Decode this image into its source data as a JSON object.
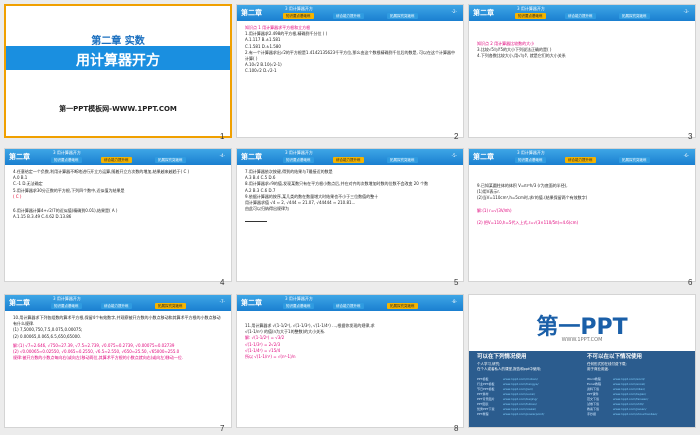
{
  "slides": [
    {
      "num": "1",
      "chapter": "第二章 实数",
      "title": "用计算器开方",
      "site": "第一PPT模板网-WWW.1PPT.COM"
    },
    {
      "num": "2",
      "header": "第二章",
      "section": "3 用计算器开方",
      "tabs": [
        "知识要点基础练",
        "综合能力提升练",
        "拓展探究突破练"
      ],
      "page": "-2-",
      "lines": [
        "知识点 1  用计算器求平方根和立方根",
        "1.用计算器求2.498的平方根,精确到千分位 (    )",
        "A.1.117          B.±1.581",
        "C.1.581          D.±1.580",
        "2.有一个计算器求出√2的平方根是1.4142135623千平方位,那么由这个数根精确到千位后的数是, 可以在这个计算器中计算(    )",
        "A.10√2          B.10(√2-1)",
        "C.100√2         D.√2-1"
      ]
    },
    {
      "num": "3",
      "header": "第二章",
      "section": "3 用计算器开方",
      "tabs": [
        "知识要点基础练",
        "综合能力提升练",
        "拓展探究突破练"
      ],
      "page": "-3-",
      "lines": [
        "知识点 2  用计算器比较数的大小",
        "3.比较√5与∛5的大小下列说法正确的是(   )",
        "4.下列各数比较大小,用√与∛, 就是它们的大小关系"
      ]
    },
    {
      "num": "4",
      "header": "第二章",
      "section": "3 用计算器开方",
      "tabs": [
        "知识要点基础练",
        "综合能力提升练",
        "拓展探究突破练"
      ],
      "page": "-4-",
      "lines": [
        "4.任意给定一个负数,利用计算器不断地进行开立方运算,随着开立方次数的增加,结果越来越趋于(  C  )",
        "A.0        B.1",
        "C.-1       D.无法确定",
        "5.用计算器求30分正数的平方根,下列四个数中,近似值为结果是",
        "(  C  )",
        "6.用计算器计算4+√2/7的近似值(精确到0.01),结果是(  A  )",
        "A.1.15   B.3.49  C.4.62   D.13.86"
      ]
    },
    {
      "num": "5",
      "header": "第二章",
      "section": "3 用计算器开方",
      "tabs": [
        "知识要点基础练",
        "综合能力提升练",
        "拓展探究突破练"
      ],
      "page": "-5-",
      "lines": [
        "7.用计算器依次按键,得到的结果与7最接近的数是",
        "A.3      B.4      C.5      D.6",
        "8.用计算器求√9的值,发现某数只有在平方根小数点后,并在对齐的次数增加时数的位数不会改变 20 个数",
        "A.2      B.3      C.6      D.7",
        "9.依据计算器的按序,某几类的数在数量增大时结果也不小于三位数值的整十",
        "用计算器求值 √4 ≈ 2, √444 ≈ 21.07, √44444 ≈ 210.81...",
        "由此可以归纳得出规律为"
      ]
    },
    {
      "num": "6",
      "header": "第二章",
      "section": "3 用计算器开方",
      "tabs": [
        "知识要点基础练",
        "综合能力提升练",
        "拓展探究突破练"
      ],
      "page": "-6-",
      "lines": [
        "9.已知某圆柱体的体积 V=πr²h/3 (r为底面的半径),",
        "(1)用V表示r.",
        "(2)当V=110cm³,h=5cm时,求r的值.(结果保留两个有效数字)",
        "解:(1) r=√(3V/πh)",
        "(2) 把V=110,h=5代入上式,r=√(3×110/5π)≈4.6(cm)"
      ]
    },
    {
      "num": "7",
      "header": "第二章",
      "section": "3 用计算器开方",
      "tabs": [
        "知识要点基础练",
        "综合能力提升练",
        "拓展探究突破练"
      ],
      "page": "-7-",
      "lines": [
        "10.用计算器求下列各组数的算术平方根,保留4个有效数字,并观察被开方数的小数点移动和其算术平方根的小数点移动有什么规律.",
        "(1) 7,5000,750,7.5,0.075,0.00075;",
        "(2) 0.00065,0.065,6.5,650,65000.",
        "解:(1) √7≈2.646, √750≈27.39, √7.5≈2.739, √0.075≈0.2739, √0.00075≈0.02739",
        "(2) √0.00065≈0.02550, √0.065≈0.2550, √6.5≈2.550, √650≈25.50, √65000≈255.0",
        "规律:被开方数的小数点每向右(或向左)移动两位,其算术平方根的小数点就向右(或向左)移动一位."
      ]
    },
    {
      "num": "8",
      "header": "第二章",
      "section": "3 用计算器开方",
      "tabs": [
        "知识要点基础练",
        "综合能力提升练",
        "拓展探究突破练"
      ],
      "page": "-8-",
      "lines": [
        "11.用计算器求 √(1-1/2²), √(1-1/3²), √(1-1/4²) …,根据你发现的规律,求",
        "√(1-1/n²) 的值(n为大于1的整数)的大小关系.",
        "解: √(1-1/2²) = √3/2",
        "√(1-1/3²) = 2√2/3",
        "√(1-1/4²) = √15/4",
        "所以 √(1-1/n²) = √(n²-1)/n"
      ]
    },
    {
      "num": "",
      "logo": "第一PPT",
      "url": "WWW.1PPT.COM",
      "can_title": "可以在下列情况使用",
      "can_items": [
        "个人学习,研究;",
        "在个人或者私人的课堂,报告和ppt中使用;"
      ],
      "cannot_title": "不可以在以下情况使用",
      "cannot_items": [
        "任何形式的在线付费下载;",
        "用于商业用途."
      ],
      "links": [
        [
          "PPT模板",
          "www.1ppt.com/moban/"
        ],
        [
          "行业PPT模板",
          "www.1ppt.com/hangye/"
        ],
        [
          "节日PPT模板",
          "www.1ppt.com/jieri/"
        ],
        [
          "PPT素材",
          "www.1ppt.com/sucai/"
        ],
        [
          "PPT背景图片",
          "www.1ppt.com/beijing/"
        ],
        [
          "PPT图表",
          "www.1ppt.com/tubiao/"
        ],
        [
          "优秀PPT下载",
          "www.1ppt.com/xiazai/"
        ],
        [
          "PPT教程",
          "www.1ppt.com/powerpoint/"
        ]
      ],
      "links2": [
        [
          "Word教程",
          "www.1ppt.com/word/"
        ],
        [
          "Excel教程",
          "www.1ppt.com/excel/"
        ],
        [
          "资料下载",
          "www.1ppt.com/ziliao/"
        ],
        [
          "PPT课件",
          "www.1ppt.com/kejian/"
        ],
        [
          "范文下载",
          "www.1ppt.com/fanwen/"
        ],
        [
          "试卷下载",
          "www.1ppt.com/shiti/"
        ],
        [
          "教案下载",
          "www.1ppt.com/jiaoan/"
        ],
        [
          "手抄报",
          "www.1ppt.com/shouchaobao/"
        ]
      ]
    }
  ]
}
